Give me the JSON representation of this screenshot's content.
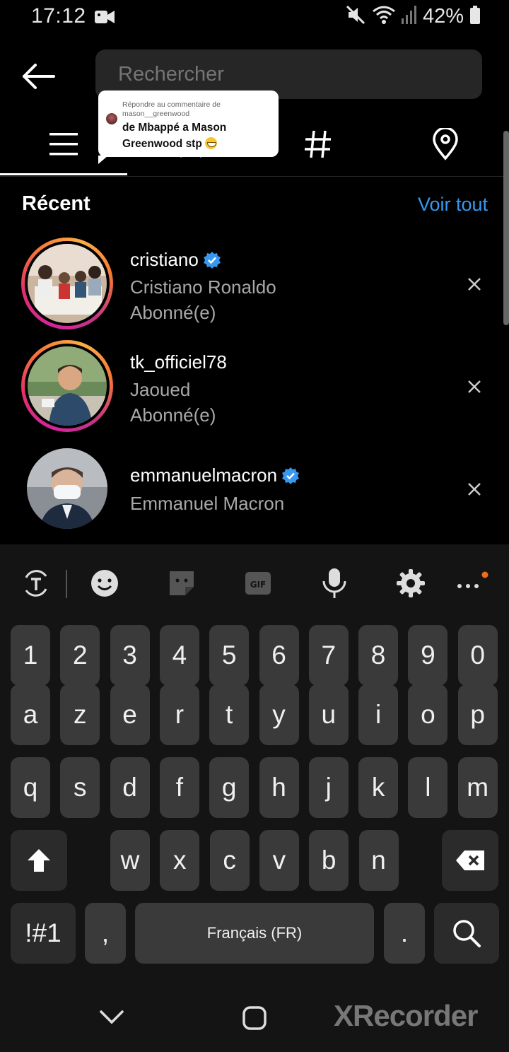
{
  "status_bar": {
    "time": "17:12",
    "battery_pct": "42%"
  },
  "search": {
    "placeholder": "Rechercher"
  },
  "tabs": [
    {
      "name": "top",
      "icon": "menu-lines-icon",
      "active": true
    },
    {
      "name": "accounts",
      "icon": "person-icon",
      "active": false
    },
    {
      "name": "tags",
      "icon": "hashtag-icon",
      "active": false
    },
    {
      "name": "places",
      "icon": "location-pin-icon",
      "active": false
    }
  ],
  "comment_bubble": {
    "reply_label_line1": "Répondre au commentaire de",
    "reply_label_line2": "mason__greenwood",
    "text_line1": "de Mbappé a Mason",
    "text_line2": "Greenwood stp"
  },
  "recent": {
    "title": "Récent",
    "see_all": "Voir tout",
    "items": [
      {
        "username": "cristiano",
        "verified": true,
        "full_name": "Cristiano Ronaldo",
        "status": "Abonné(e)",
        "story_ring": true
      },
      {
        "username": "tk_officiel78",
        "verified": false,
        "full_name": "Jaoued",
        "status": "Abonné(e)",
        "story_ring": true
      },
      {
        "username": "emmanuelmacron",
        "verified": true,
        "full_name": "Emmanuel Macron",
        "status": "",
        "story_ring": false
      }
    ]
  },
  "keyboard": {
    "row_numbers": [
      "1",
      "2",
      "3",
      "4",
      "5",
      "6",
      "7",
      "8",
      "9",
      "0"
    ],
    "row_1": [
      "a",
      "z",
      "e",
      "r",
      "t",
      "y",
      "u",
      "i",
      "o",
      "p"
    ],
    "row_2": [
      "q",
      "s",
      "d",
      "f",
      "g",
      "h",
      "j",
      "k",
      "l",
      "m"
    ],
    "row_3": [
      "w",
      "x",
      "c",
      "v",
      "b",
      "n"
    ],
    "symbols_key": "!#1",
    "comma_key": ",",
    "space_label": "Français (FR)",
    "period_key": ".",
    "toolbar_tools": [
      "text-translate-icon",
      "emoji-icon",
      "sticker-icon",
      "gif-icon",
      "microphone-icon",
      "settings-gear-icon",
      "more-dots-icon"
    ]
  },
  "watermark": "XRecorder",
  "colors": {
    "accent_link": "#3897f0",
    "verified_badge": "#3897f0",
    "background": "#000000",
    "keyboard_bg": "#141414",
    "key_bg": "#3a3a3a"
  }
}
